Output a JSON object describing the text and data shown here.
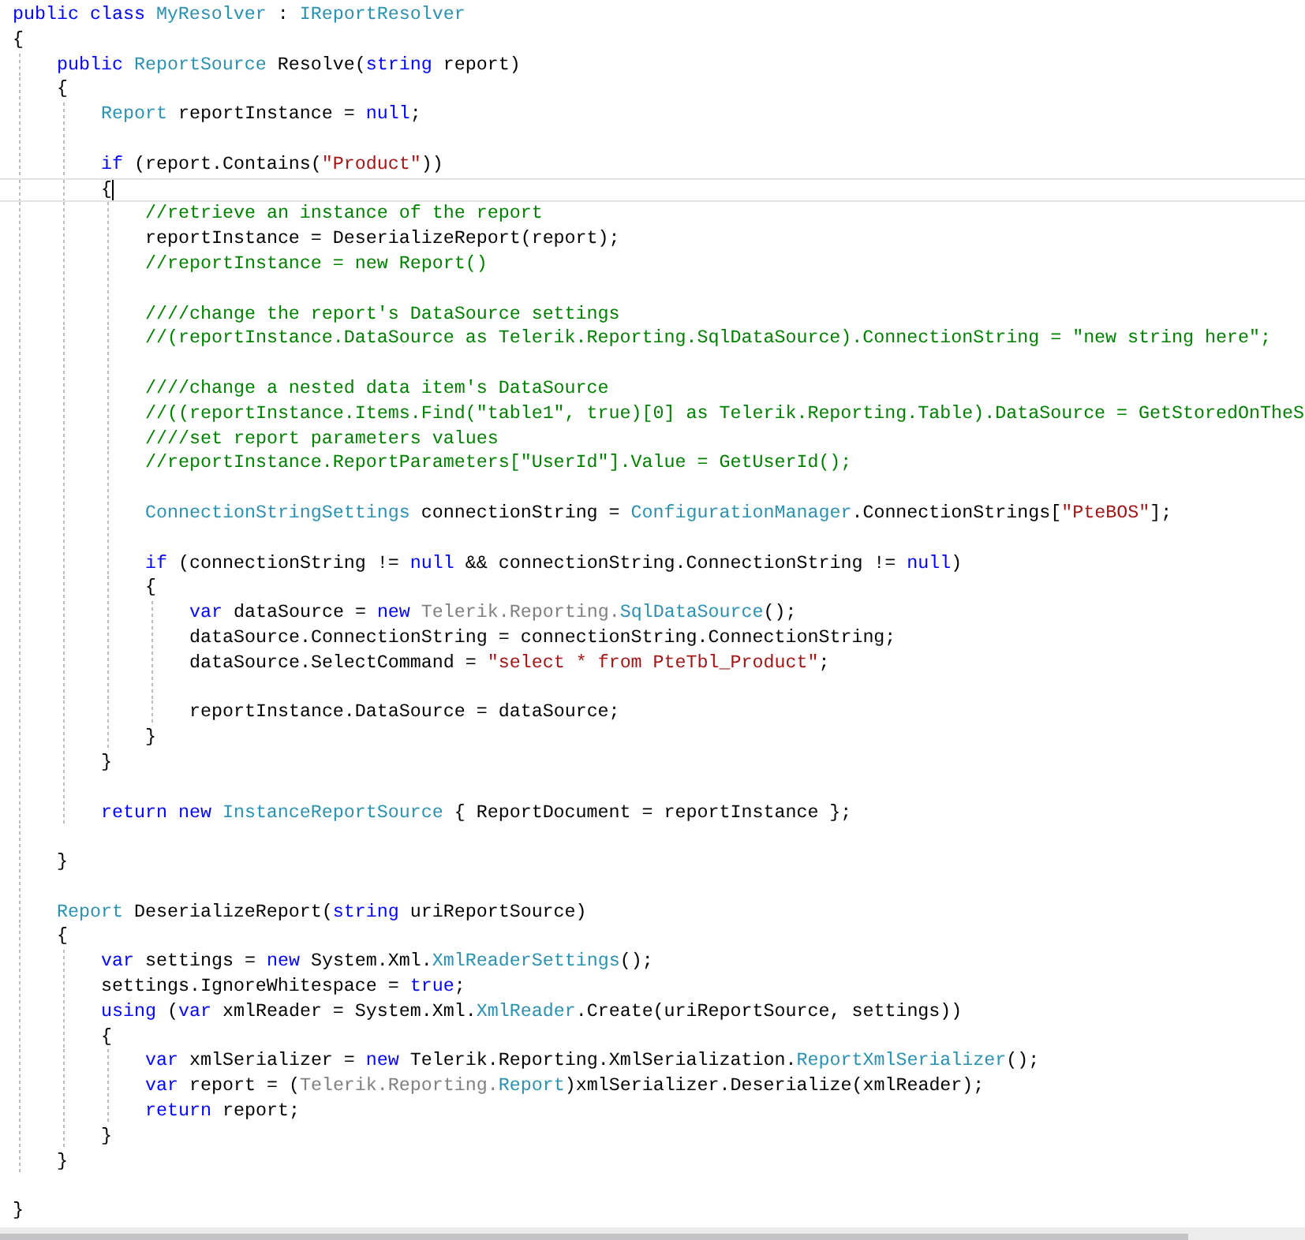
{
  "editor": {
    "lines": [
      {
        "current": false,
        "tokens": [
          {
            "kind": "keyword",
            "text": "public class "
          },
          {
            "kind": "type",
            "text": "MyResolver"
          },
          {
            "kind": "plain",
            "text": " : "
          },
          {
            "kind": "type",
            "text": "IReportResolver"
          }
        ]
      },
      {
        "current": false,
        "tokens": [
          {
            "kind": "plain",
            "text": "{"
          }
        ]
      },
      {
        "current": false,
        "tokens": [
          {
            "kind": "keyword",
            "text": "    public "
          },
          {
            "kind": "type",
            "text": "ReportSource"
          },
          {
            "kind": "plain",
            "text": " Resolve("
          },
          {
            "kind": "keyword",
            "text": "string"
          },
          {
            "kind": "plain",
            "text": " report)"
          }
        ]
      },
      {
        "current": false,
        "tokens": [
          {
            "kind": "plain",
            "text": "    {"
          }
        ]
      },
      {
        "current": false,
        "tokens": [
          {
            "kind": "type",
            "text": "        Report"
          },
          {
            "kind": "plain",
            "text": " reportInstance = "
          },
          {
            "kind": "keyword",
            "text": "null"
          },
          {
            "kind": "plain",
            "text": ";"
          }
        ]
      },
      {
        "current": false
      },
      {
        "current": false,
        "tokens": [
          {
            "kind": "keyword",
            "text": "        if"
          },
          {
            "kind": "plain",
            "text": " (report.Contains("
          },
          {
            "kind": "string",
            "text": "\"Product\""
          },
          {
            "kind": "plain",
            "text": "))"
          }
        ]
      },
      {
        "current": true,
        "tokens": [
          {
            "kind": "plain",
            "text": "        {"
          }
        ]
      },
      {
        "current": false,
        "tokens": [
          {
            "kind": "comment",
            "text": "            //retrieve an instance of the report"
          }
        ]
      },
      {
        "current": false,
        "tokens": [
          {
            "kind": "plain",
            "text": "            reportInstance = DeserializeReport(report);"
          }
        ]
      },
      {
        "current": false,
        "tokens": [
          {
            "kind": "comment",
            "text": "            //reportInstance = new Report()"
          }
        ]
      },
      {
        "current": false
      },
      {
        "current": false,
        "tokens": [
          {
            "kind": "comment",
            "text": "            ////change the report's DataSource settings"
          }
        ]
      },
      {
        "current": false,
        "tokens": [
          {
            "kind": "comment",
            "text": "            //(reportInstance.DataSource as Telerik.Reporting.SqlDataSource).ConnectionString = \"new string here\";"
          }
        ]
      },
      {
        "current": false
      },
      {
        "current": false,
        "tokens": [
          {
            "kind": "comment",
            "text": "            ////change a nested data item's DataSource"
          }
        ]
      },
      {
        "current": false,
        "tokens": [
          {
            "kind": "comment",
            "text": "            //((reportInstance.Items.Find(\"table1\", true)[0] as Telerik.Reporting.Table).DataSource = GetStoredOnTheS"
          }
        ]
      },
      {
        "current": false,
        "tokens": [
          {
            "kind": "comment",
            "text": "            ////set report parameters values"
          }
        ]
      },
      {
        "current": false,
        "tokens": [
          {
            "kind": "comment",
            "text": "            //reportInstance.ReportParameters[\"UserId\"].Value = GetUserId();"
          }
        ]
      },
      {
        "current": false
      },
      {
        "current": false,
        "tokens": [
          {
            "kind": "type",
            "text": "            ConnectionStringSettings"
          },
          {
            "kind": "plain",
            "text": " connectionString = "
          },
          {
            "kind": "type",
            "text": "ConfigurationManager"
          },
          {
            "kind": "plain",
            "text": ".ConnectionStrings["
          },
          {
            "kind": "string",
            "text": "\"PteBOS\""
          },
          {
            "kind": "plain",
            "text": "];"
          }
        ]
      },
      {
        "current": false
      },
      {
        "current": false,
        "tokens": [
          {
            "kind": "keyword",
            "text": "            if"
          },
          {
            "kind": "plain",
            "text": " (connectionString != "
          },
          {
            "kind": "keyword",
            "text": "null"
          },
          {
            "kind": "plain",
            "text": " && connectionString.ConnectionString != "
          },
          {
            "kind": "keyword",
            "text": "null"
          },
          {
            "kind": "plain",
            "text": ")"
          }
        ]
      },
      {
        "current": false,
        "tokens": [
          {
            "kind": "plain",
            "text": "            {"
          }
        ]
      },
      {
        "current": false,
        "tokens": [
          {
            "kind": "keyword",
            "text": "                var"
          },
          {
            "kind": "plain",
            "text": " dataSource = "
          },
          {
            "kind": "keyword",
            "text": "new "
          },
          {
            "kind": "namespace",
            "text": "Telerik.Reporting."
          },
          {
            "kind": "type",
            "text": "SqlDataSource"
          },
          {
            "kind": "plain",
            "text": "();"
          }
        ]
      },
      {
        "current": false,
        "tokens": [
          {
            "kind": "plain",
            "text": "                dataSource.ConnectionString = connectionString.ConnectionString;"
          }
        ]
      },
      {
        "current": false,
        "tokens": [
          {
            "kind": "plain",
            "text": "                dataSource.SelectCommand = "
          },
          {
            "kind": "string",
            "text": "\"select * from PteTbl_Product\""
          },
          {
            "kind": "plain",
            "text": ";"
          }
        ]
      },
      {
        "current": false
      },
      {
        "current": false,
        "tokens": [
          {
            "kind": "plain",
            "text": "                reportInstance.DataSource = dataSource;"
          }
        ]
      },
      {
        "current": false,
        "tokens": [
          {
            "kind": "plain",
            "text": "            }"
          }
        ]
      },
      {
        "current": false,
        "tokens": [
          {
            "kind": "plain",
            "text": "        }"
          }
        ]
      },
      {
        "current": false
      },
      {
        "current": false,
        "tokens": [
          {
            "kind": "keyword",
            "text": "        return new "
          },
          {
            "kind": "type",
            "text": "InstanceReportSource"
          },
          {
            "kind": "plain",
            "text": " { ReportDocument = reportInstance };"
          }
        ]
      },
      {
        "current": false
      },
      {
        "current": false,
        "tokens": [
          {
            "kind": "plain",
            "text": "    }"
          }
        ]
      },
      {
        "current": false
      },
      {
        "current": false,
        "tokens": [
          {
            "kind": "type",
            "text": "    Report"
          },
          {
            "kind": "plain",
            "text": " DeserializeReport("
          },
          {
            "kind": "keyword",
            "text": "string"
          },
          {
            "kind": "plain",
            "text": " uriReportSource)"
          }
        ]
      },
      {
        "current": false,
        "tokens": [
          {
            "kind": "plain",
            "text": "    {"
          }
        ]
      },
      {
        "current": false,
        "tokens": [
          {
            "kind": "keyword",
            "text": "        var"
          },
          {
            "kind": "plain",
            "text": " settings = "
          },
          {
            "kind": "keyword",
            "text": "new"
          },
          {
            "kind": "plain",
            "text": " System.Xml."
          },
          {
            "kind": "type",
            "text": "XmlReaderSettings"
          },
          {
            "kind": "plain",
            "text": "();"
          }
        ]
      },
      {
        "current": false,
        "tokens": [
          {
            "kind": "plain",
            "text": "        settings.IgnoreWhitespace = "
          },
          {
            "kind": "keyword",
            "text": "true"
          },
          {
            "kind": "plain",
            "text": ";"
          }
        ]
      },
      {
        "current": false,
        "tokens": [
          {
            "kind": "keyword",
            "text": "        using"
          },
          {
            "kind": "plain",
            "text": " ("
          },
          {
            "kind": "keyword",
            "text": "var"
          },
          {
            "kind": "plain",
            "text": " xmlReader = System.Xml."
          },
          {
            "kind": "type",
            "text": "XmlReader"
          },
          {
            "kind": "plain",
            "text": ".Create(uriReportSource, settings))"
          }
        ]
      },
      {
        "current": false,
        "tokens": [
          {
            "kind": "plain",
            "text": "        {"
          }
        ]
      },
      {
        "current": false,
        "tokens": [
          {
            "kind": "keyword",
            "text": "            var"
          },
          {
            "kind": "plain",
            "text": " xmlSerializer = "
          },
          {
            "kind": "keyword",
            "text": "new"
          },
          {
            "kind": "plain",
            "text": " Telerik.Reporting.XmlSerialization."
          },
          {
            "kind": "type",
            "text": "ReportXmlSerializer"
          },
          {
            "kind": "plain",
            "text": "();"
          }
        ]
      },
      {
        "current": false,
        "tokens": [
          {
            "kind": "keyword",
            "text": "            var"
          },
          {
            "kind": "plain",
            "text": " report = ("
          },
          {
            "kind": "namespace",
            "text": "Telerik.Reporting."
          },
          {
            "kind": "type",
            "text": "Report"
          },
          {
            "kind": "plain",
            "text": ")xmlSerializer.Deserialize(xmlReader);"
          }
        ]
      },
      {
        "current": false,
        "tokens": [
          {
            "kind": "keyword",
            "text": "            return"
          },
          {
            "kind": "plain",
            "text": " report;"
          }
        ]
      },
      {
        "current": false,
        "tokens": [
          {
            "kind": "plain",
            "text": "        }"
          }
        ]
      },
      {
        "current": false,
        "tokens": [
          {
            "kind": "plain",
            "text": "    }"
          }
        ]
      },
      {
        "current": false
      },
      {
        "current": false,
        "tokens": [
          {
            "kind": "plain",
            "text": "}"
          }
        ]
      }
    ]
  }
}
